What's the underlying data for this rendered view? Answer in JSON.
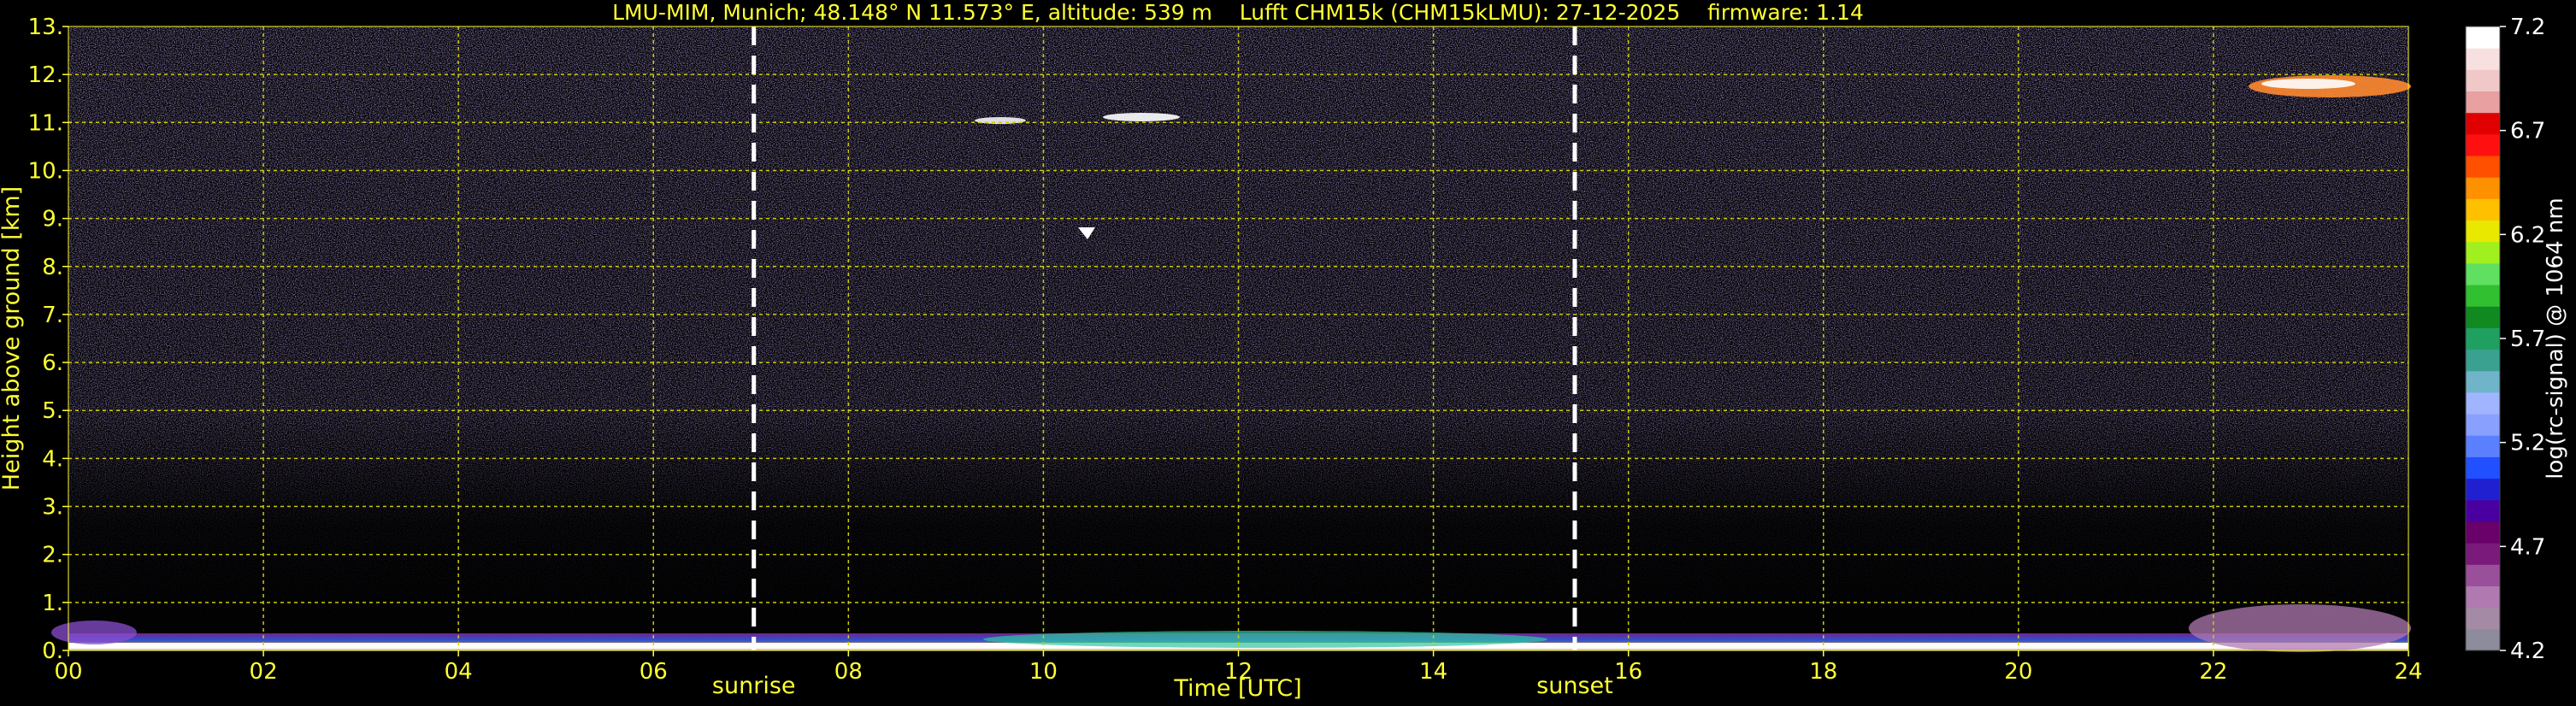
{
  "chart_data": {
    "type": "heatmap",
    "title": "LMU-MIM, Munich; 48.148° N 11.573° E, altitude: 539 m    Lufft CHM15k (CHM15kLMU): 27-12-2025    firmware: 1.14",
    "xlabel": "Time [UTC]",
    "ylabel": "Height above ground [km]",
    "colorbar_label": "log(rc-signal) @ 1064 nm",
    "xlim": [
      0,
      24
    ],
    "ylim": [
      0,
      13
    ],
    "x_ticks": [
      "00",
      "02",
      "04",
      "06",
      "08",
      "10",
      "12",
      "14",
      "16",
      "18",
      "20",
      "22",
      "24"
    ],
    "x_tick_values": [
      0,
      2,
      4,
      6,
      8,
      10,
      12,
      14,
      16,
      18,
      20,
      22,
      24
    ],
    "y_ticks": [
      "0.",
      "1.",
      "2.",
      "3.",
      "4.",
      "5.",
      "6.",
      "7.",
      "8.",
      "9.",
      "10.",
      "11.",
      "12.",
      "13."
    ],
    "y_tick_values": [
      0,
      1,
      2,
      3,
      4,
      5,
      6,
      7,
      8,
      9,
      10,
      11,
      12,
      13
    ],
    "colorbar_ticks": [
      "4.2",
      "4.7",
      "5.2",
      "5.7",
      "6.2",
      "6.7",
      "7.2"
    ],
    "colorbar_tick_values": [
      4.2,
      4.7,
      5.2,
      5.7,
      6.2,
      6.7,
      7.2
    ],
    "colorbar_range": [
      4.2,
      7.2
    ],
    "colorbar_colors": [
      "#8c8c9c",
      "#a58aa5",
      "#b07ab0",
      "#9a4f9a",
      "#7a1a7a",
      "#6a006a",
      "#4a00a0",
      "#2020d0",
      "#2050ff",
      "#5a80ff",
      "#8aa0ff",
      "#a0b4ff",
      "#6fb4c8",
      "#3aa090",
      "#20a060",
      "#108a20",
      "#30c030",
      "#60e060",
      "#a0f020",
      "#e8e800",
      "#ffc000",
      "#ff9000",
      "#ff5000",
      "#ff1010",
      "#e00000",
      "#e8a0a0",
      "#f0c8c8",
      "#f8e0e0",
      "#ffffff"
    ],
    "events": [
      {
        "label": "sunrise",
        "x": 7.03
      },
      {
        "label": "sunset",
        "x": 15.45
      }
    ],
    "grid": true,
    "colors": {
      "background": "#000000",
      "text": "#ffff33",
      "grid": "#cccc00",
      "noise": "#6a4fa8",
      "event_line": "#ffffff"
    }
  }
}
